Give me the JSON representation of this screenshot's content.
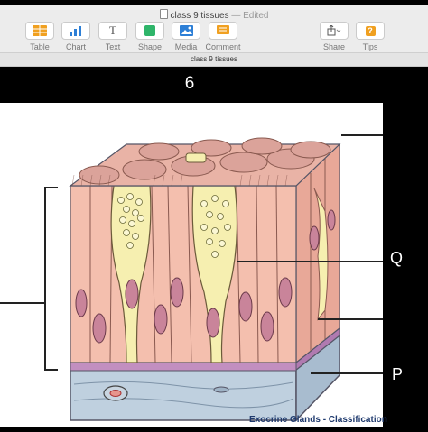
{
  "document": {
    "title": "class 9 tissues",
    "status": "— Edited",
    "tab_name": "class 9 tissues"
  },
  "toolbar": {
    "left_tools": [
      {
        "label": "Table",
        "icon": "table-icon"
      },
      {
        "label": "Chart",
        "icon": "chart-icon"
      },
      {
        "label": "Text",
        "icon": "text-icon"
      },
      {
        "label": "Shape",
        "icon": "shape-icon"
      },
      {
        "label": "Media",
        "icon": "media-icon"
      },
      {
        "label": "Comment",
        "icon": "comment-icon"
      }
    ],
    "right_tools": [
      {
        "label": "Share",
        "icon": "share-icon"
      },
      {
        "label": "Tips",
        "icon": "tips-icon"
      }
    ]
  },
  "slide": {
    "number": "6",
    "label_q": "Q",
    "label_p": "P",
    "caption": "Exocrine Glands - Classification"
  },
  "colors": {
    "accent_orange": "#f0a020",
    "accent_blue": "#2d7fd6",
    "accent_green": "#2fb56a",
    "cell_pink": "#f4bfae",
    "goblet_yellow": "#f6efb0",
    "basement_purple": "#c28fc0",
    "connective_blue": "#bfd0df"
  }
}
